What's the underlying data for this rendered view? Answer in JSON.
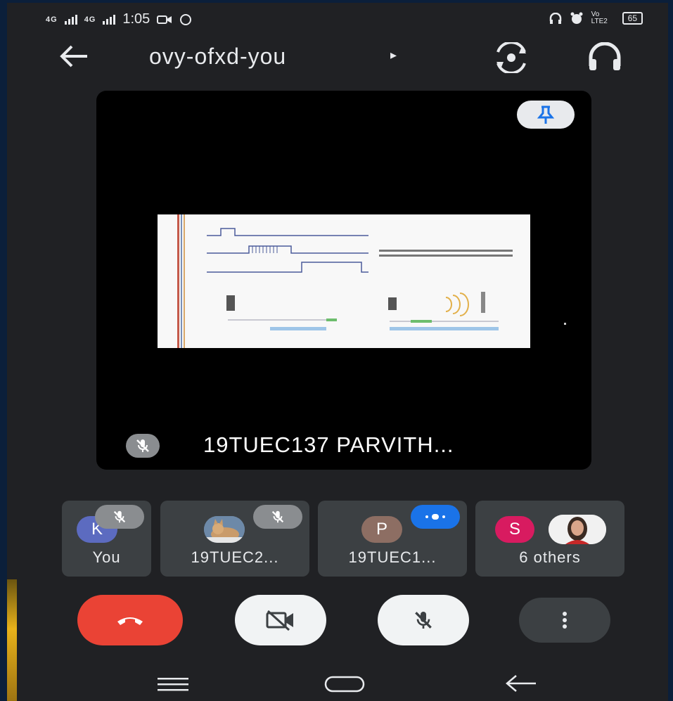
{
  "status_bar": {
    "time": "1:05",
    "signal_1": "4G",
    "signal_2": "4G",
    "volte": "Vo LTE2",
    "battery": "65"
  },
  "meeting": {
    "code": "ovy-ofxd-you"
  },
  "stage": {
    "presenter_name": "19TUEC137 PARVITH..."
  },
  "participants": [
    {
      "initial": "K",
      "label": "You",
      "color": "#5c6bc0"
    },
    {
      "initial": "",
      "label": "19TUEC2...",
      "color": "#7b8fa6"
    },
    {
      "initial": "P",
      "label": "19TUEC1...",
      "color": "#8d6e63"
    },
    {
      "initial": "S",
      "label": "6 others",
      "color": "#d81b60"
    }
  ],
  "icons": {
    "back": "arrow-left-icon",
    "switch_camera": "switch-camera-icon",
    "audio": "headphones-icon",
    "pin": "pin-icon",
    "mic_off": "mic-off-icon",
    "end_call": "end-call-icon",
    "camera_off": "camera-off-icon",
    "more": "more-vert-icon"
  },
  "colors": {
    "end_call": "#ea4335",
    "speaking": "#1a73e8",
    "pin": "#1a73e8"
  }
}
